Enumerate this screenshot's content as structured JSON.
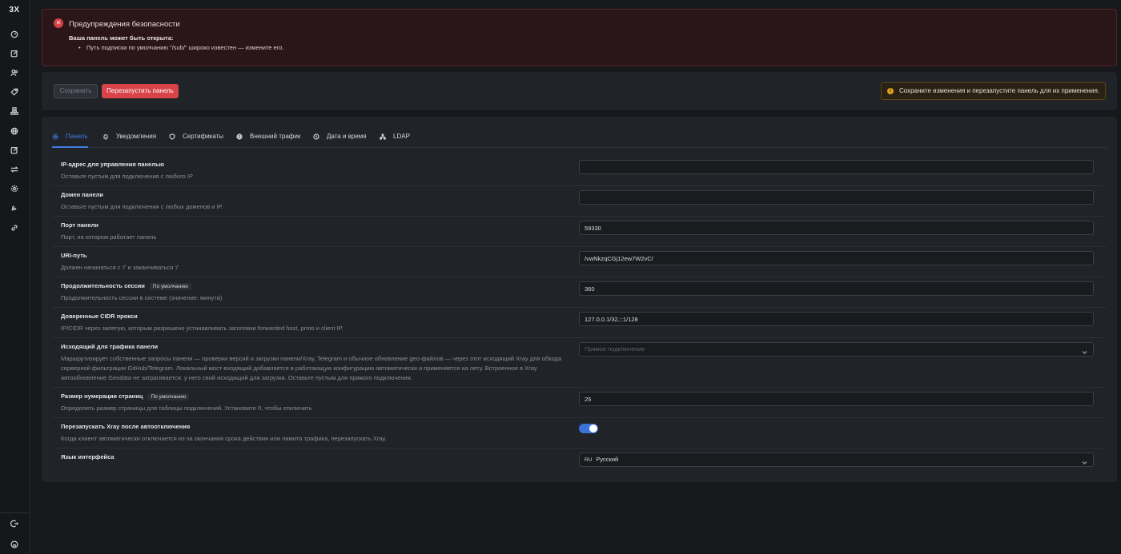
{
  "app": {
    "brand": "3X"
  },
  "sidebar": {
    "icons": [
      "dashboard-icon",
      "inbounds-icon",
      "clients-icon",
      "tag-icon",
      "nodes-icon",
      "globe-icon",
      "edit-icon",
      "routing-icon",
      "settings-icon",
      "wrench-icon",
      "link-icon"
    ],
    "bottom_icons": [
      "logout-icon",
      "github-icon"
    ]
  },
  "alert": {
    "title": "Предупреждения безопасности",
    "subtitle": "Ваша панель может быть открыта:",
    "items": [
      "Путь подписки по умолчанию \"/sub/\" широко известен — измените его."
    ]
  },
  "actions": {
    "save_label": "Сохранить",
    "restart_label": "Перезапустить панель",
    "warning_text": "Сохраните изменения и перезапустите панель для их применения."
  },
  "tabs": [
    {
      "label": "Панель",
      "icon": "gear-icon",
      "active": true
    },
    {
      "label": "Уведомления",
      "icon": "bell-icon",
      "active": false
    },
    {
      "label": "Сертификаты",
      "icon": "shield-icon",
      "active": false
    },
    {
      "label": "Внешний трафик",
      "icon": "globe-icon",
      "active": false
    },
    {
      "label": "Дата и время",
      "icon": "clock-icon",
      "active": false
    },
    {
      "label": "LDAP",
      "icon": "network-icon",
      "active": false
    }
  ],
  "settings": {
    "default_badge": "По умолчанию",
    "rows": [
      {
        "title": "IP-адрес для управления панелью",
        "desc": "Оставьте пустым для подключения с любого IP",
        "value": ""
      },
      {
        "title": "Домен панели",
        "desc": "Оставьте пустым для подключения с любых доменов и IP.",
        "value": ""
      },
      {
        "title": "Порт панели",
        "desc": "Порт, на котором работает панель",
        "value": "59330"
      },
      {
        "title": "URI-путь",
        "desc": "Должен начинаться с '/' и заканчиваться '/'",
        "value": "/vwNkzqCGj12ew7W2vC/"
      },
      {
        "title": "Продолжительность сессии",
        "desc": "Продолжительность сессии в системе (значение: минута)",
        "value": "360"
      },
      {
        "title": "Доверенные CIDR прокси",
        "desc": "IP/CIDR через запятую, которым разрешено устанавливать заголовки forwarded host, proto и client IP.",
        "value": "127.0.0.1/32,::1/128"
      },
      {
        "title": "Исходящий для трафика панели",
        "desc": "Маршрутизирует собственные запросы панели — проверки версий и загрузки панели/Xray, Telegram и обычное обновление geo-файлов — через этот исходящий Xray для обхода серверной фильтрации GitHub/Telegram. Локальный мост-входящий добавляется в работающую конфигурацию автоматически и применяется на лету. Встроенное в Xray автообновление Geodata не затрагивается: у него свой исходящий для загрузки. Оставьте пустым для прямого подключения.",
        "placeholder": "Прямое подключение"
      },
      {
        "title": "Размер нумерации страниц",
        "desc": "Определить размер страницы для таблицы подключений. Установите 0, чтобы отключить",
        "value": "25"
      },
      {
        "title": "Перезапускать Xray после автоотключения",
        "desc": "Когда клиент автоматически отключается из-за окончания срока действия или лимита трафика, перезапускать Xray.",
        "toggle": true
      },
      {
        "title": "Язык интерфейса",
        "lang_code": "RU",
        "value": "Русский"
      }
    ]
  }
}
